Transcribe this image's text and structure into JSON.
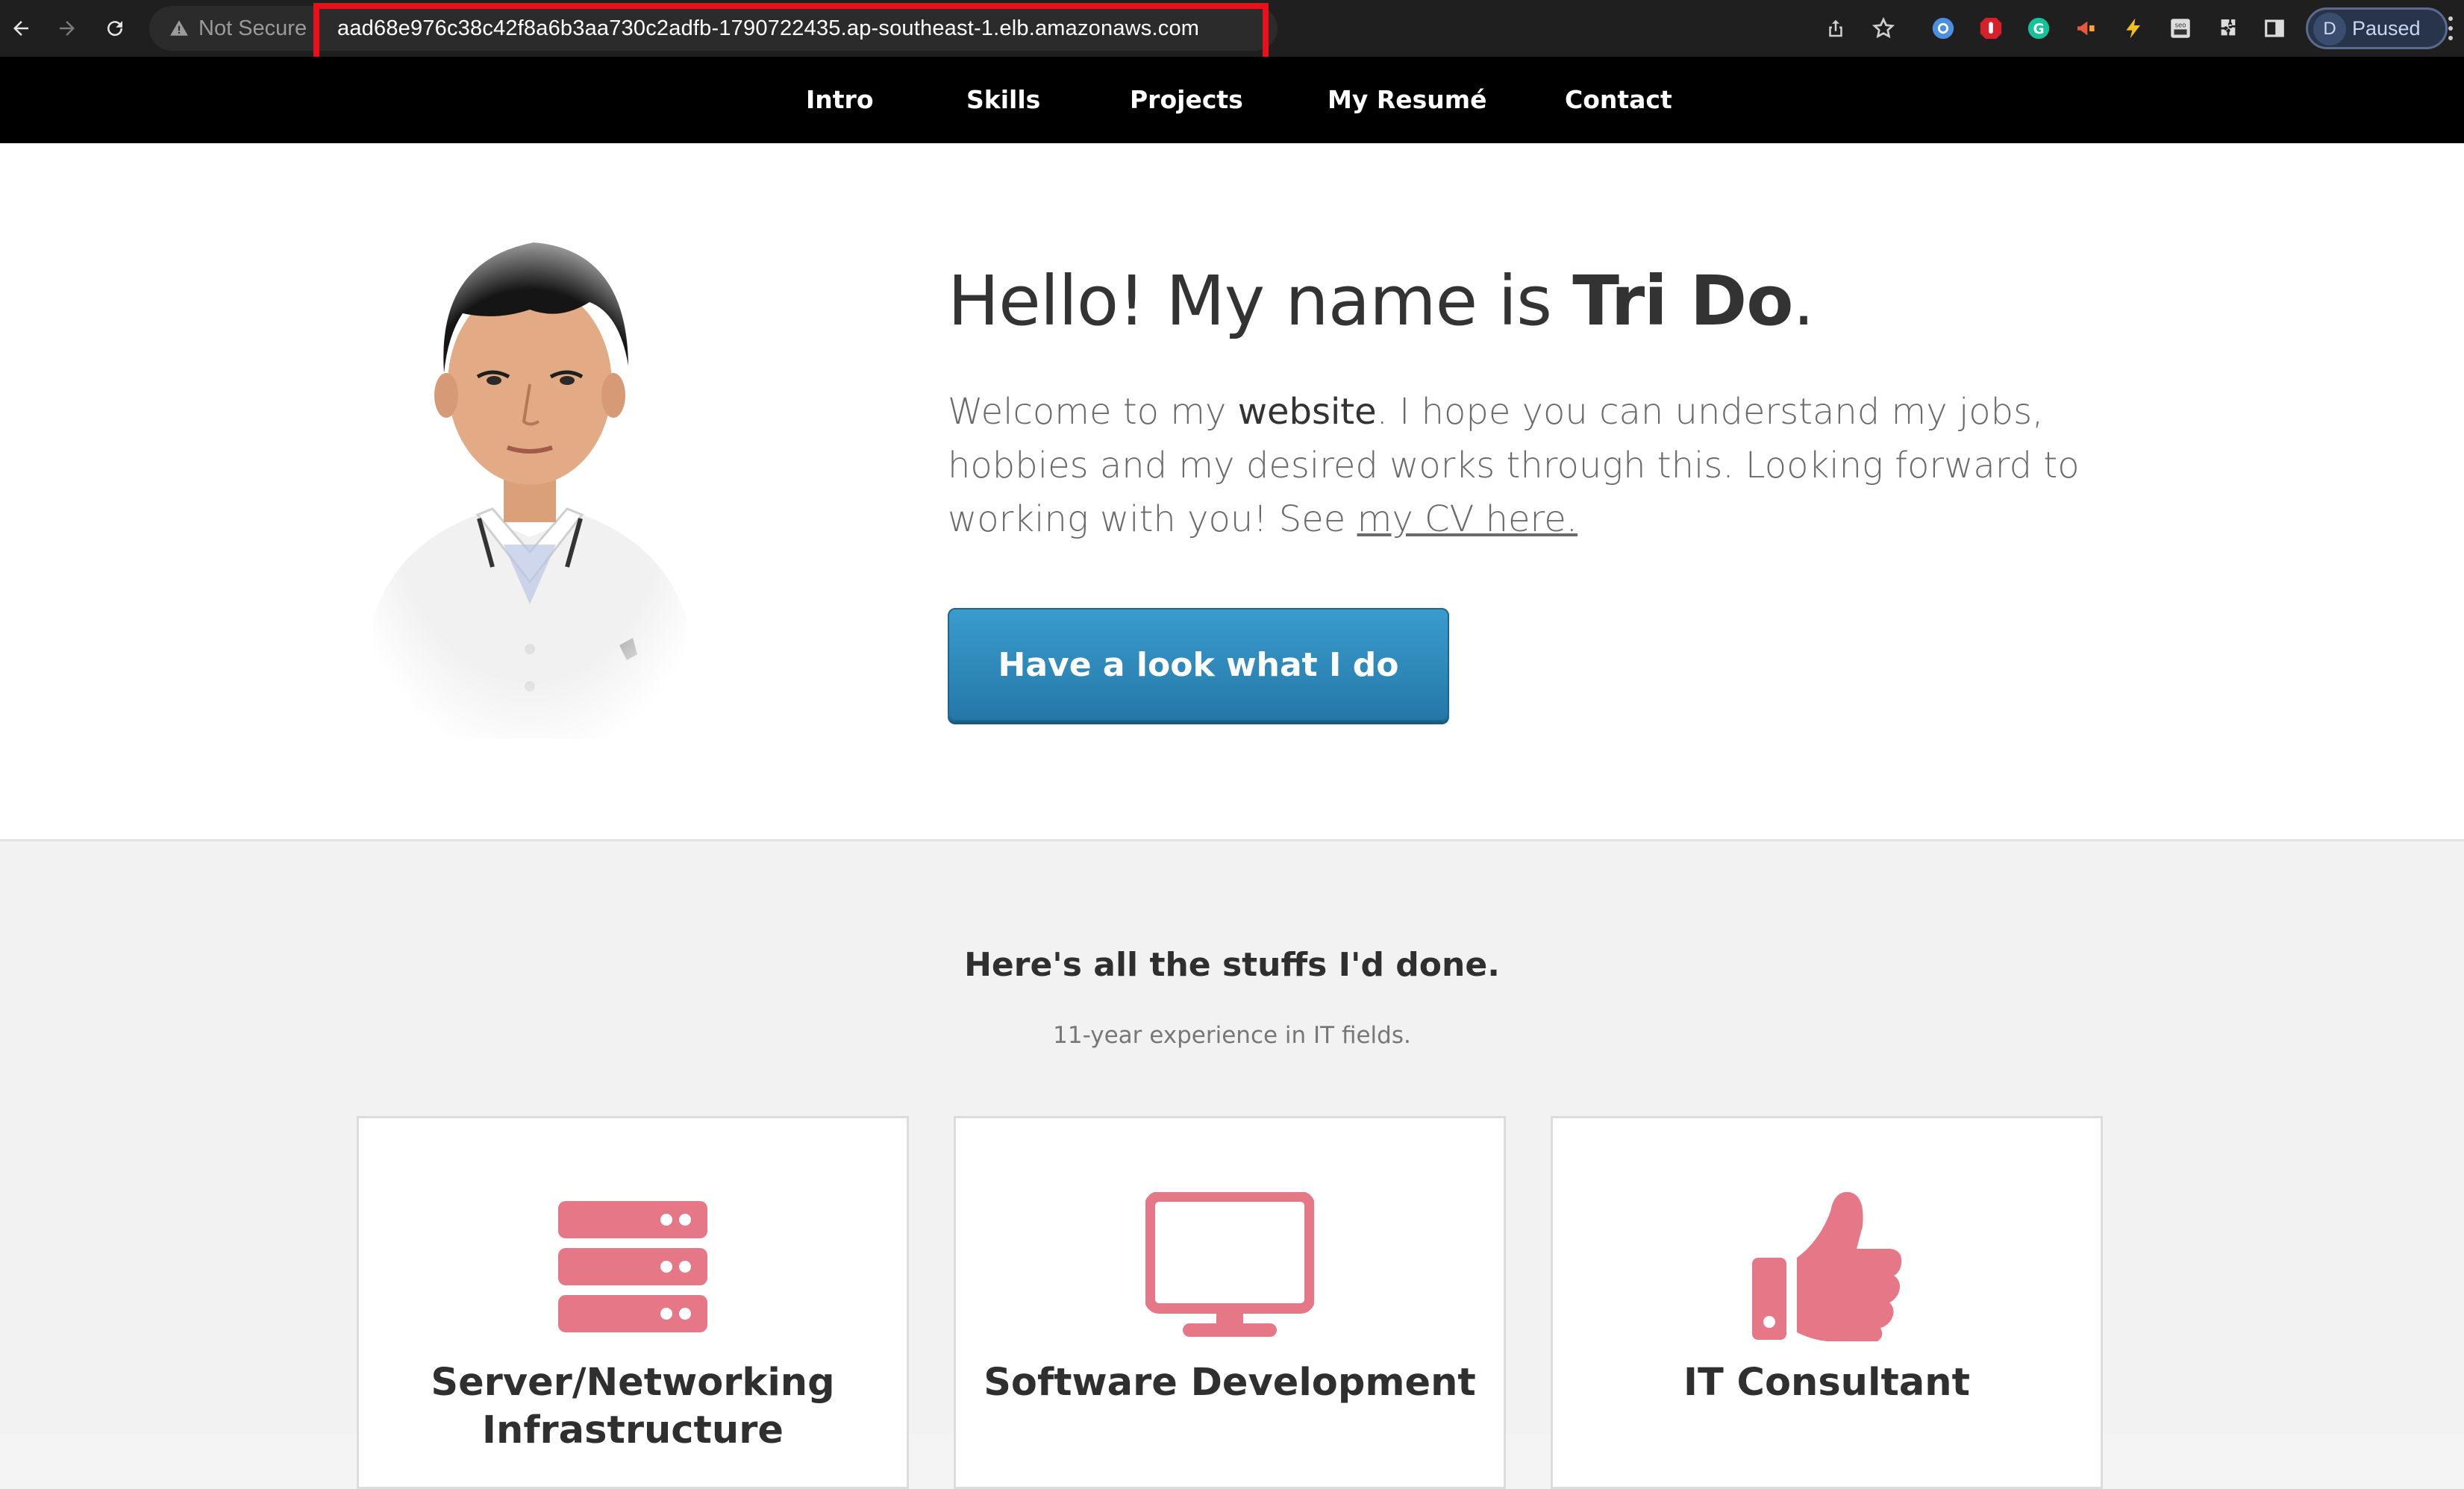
{
  "browser": {
    "security_label": "Not Secure",
    "url": "aad68e976c38c42f8a6b3aa730c2adfb-1790722435.ap-southeast-1.elb.amazonaws.com",
    "profile_initial": "D",
    "profile_status": "Paused"
  },
  "site_nav": {
    "items": [
      "Intro",
      "Skills",
      "Projects",
      "My Resumé",
      "Contact"
    ]
  },
  "hero": {
    "greeting": "Hello! My name is ",
    "name": "Tri Do",
    "greeting_end": ".",
    "intro_1": "Welcome to my ",
    "intro_bold": "website",
    "intro_2": ". I hope you can understand my jobs, hobbies and my desired works through this. Looking forward to working with you! See ",
    "cv_link": "my CV here.",
    "cta_label": "Have a look what I do"
  },
  "services": {
    "title": "Here's all the stuffs I'd done.",
    "subtitle": "11-year experience in IT fields.",
    "accent_color": "#e57787",
    "cards": [
      {
        "icon": "server-icon",
        "title": "Server/Networking Infrastructure"
      },
      {
        "icon": "monitor-icon",
        "title": "Software Development"
      },
      {
        "icon": "thumbs-up-icon",
        "title": "IT Consultant"
      }
    ]
  }
}
